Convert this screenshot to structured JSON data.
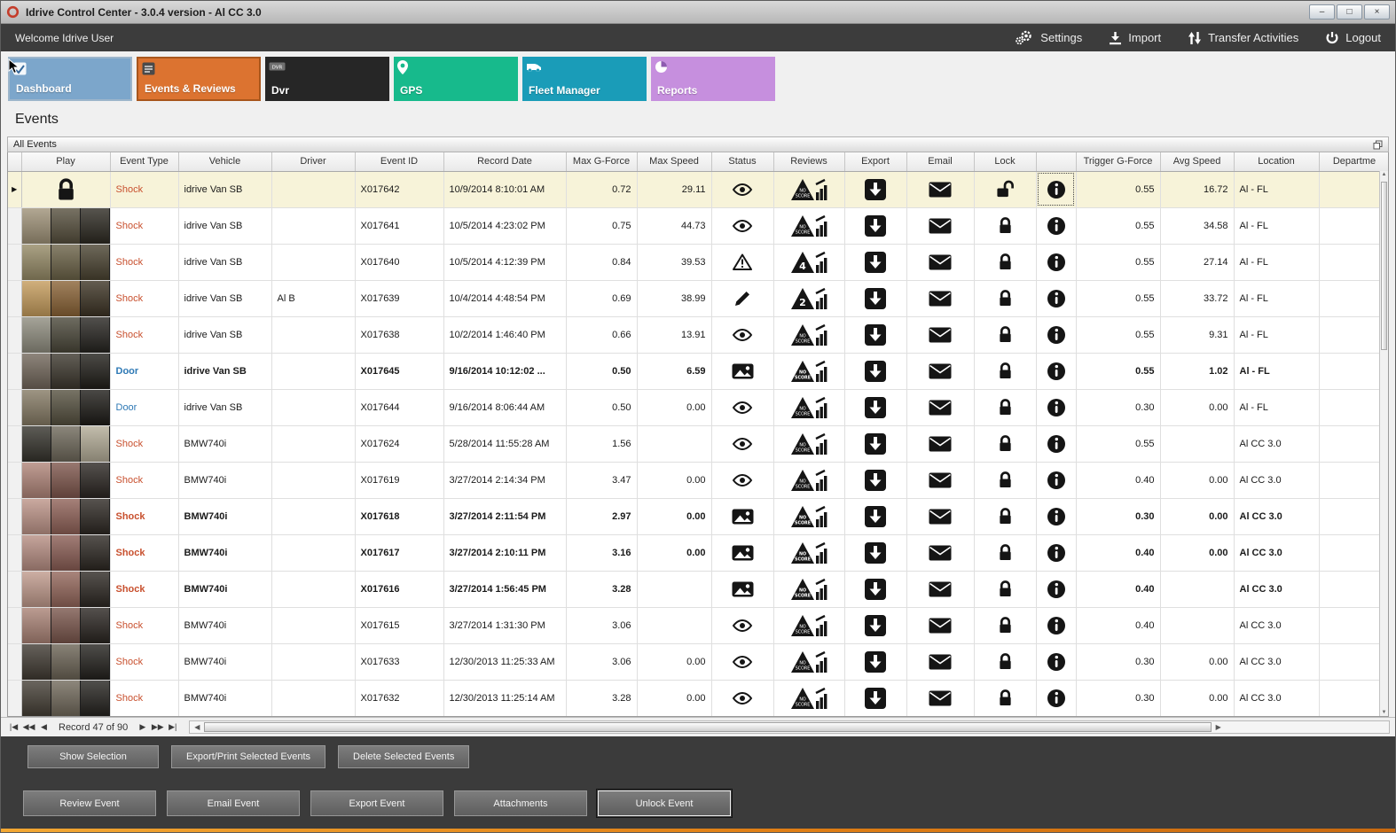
{
  "window_title": "Idrive Control Center - 3.0.4 version - Al CC 3.0",
  "window_controls": {
    "minimize": "–",
    "maximize": "□",
    "close": "×"
  },
  "topbar": {
    "welcome": "Welcome Idrive User",
    "actions": [
      {
        "id": "settings",
        "label": "Settings",
        "icon": "gear-icon"
      },
      {
        "id": "import",
        "label": "Import",
        "icon": "import-icon"
      },
      {
        "id": "transfer-activities",
        "label": "Transfer Activities",
        "icon": "transfer-icon"
      },
      {
        "id": "logout",
        "label": "Logout",
        "icon": "power-icon"
      }
    ]
  },
  "nav_tiles": [
    {
      "label": "Dashboard",
      "color": "#7CA6CB",
      "icon": "dashboard-icon",
      "selected": false,
      "hovered": true
    },
    {
      "label": "Events & Reviews",
      "color": "#DC7330",
      "icon": "events-icon",
      "selected": true,
      "hovered": false
    },
    {
      "label": "Dvr",
      "color": "#262626",
      "icon": "dvr-icon",
      "selected": false,
      "hovered": false
    },
    {
      "label": "GPS",
      "color": "#17BA8C",
      "icon": "gps-icon",
      "selected": false,
      "hovered": false
    },
    {
      "label": "Fleet Manager",
      "color": "#1A9CB8",
      "icon": "fleet-icon",
      "selected": false,
      "hovered": false
    },
    {
      "label": "Reports",
      "color": "#C68FDE",
      "icon": "reports-icon",
      "selected": false,
      "hovered": false
    }
  ],
  "page_title": "Events",
  "group_bar_label": "All Events",
  "table": {
    "columns": [
      "",
      "Play",
      "Event Type",
      "Vehicle",
      "Driver",
      "Event ID",
      "Record Date",
      "Max G-Force",
      "Max Speed",
      "Status",
      "Reviews",
      "Export",
      "Email",
      "Lock",
      "",
      "Trigger G-Force",
      "Avg Speed",
      "Location",
      "Departme"
    ],
    "rows": [
      {
        "play": "lock",
        "thumb": null,
        "type": "Shock",
        "vehicle": "idrive Van SB",
        "driver": "",
        "id": "X017642",
        "date": "10/9/2014 8:10:01 AM",
        "max_g": "0.72",
        "max_speed": "29.11",
        "status": "eye",
        "review": "NO SCORE",
        "lock": "unlocked",
        "trigger_g": "0.55",
        "avg_speed": "16.72",
        "location": "Al - FL",
        "selected": true,
        "bold": false,
        "info_focus": true
      },
      {
        "play": "thumb",
        "thumb": [
          "#9f9278",
          "#564f3d",
          "#2d2a22"
        ],
        "type": "Shock",
        "vehicle": "idrive Van SB",
        "driver": "",
        "id": "X017641",
        "date": "10/5/2014 4:23:02 PM",
        "max_g": "0.75",
        "max_speed": "44.73",
        "status": "eye",
        "review": "NO SCORE",
        "lock": "locked",
        "trigger_g": "0.55",
        "avg_speed": "34.58",
        "location": "Al - FL",
        "selected": false,
        "bold": false,
        "info_focus": false
      },
      {
        "play": "thumb",
        "thumb": [
          "#958a66",
          "#6b6247",
          "#4a4331"
        ],
        "type": "Shock",
        "vehicle": "idrive Van SB",
        "driver": "",
        "id": "X017640",
        "date": "10/5/2014 4:12:39 PM",
        "max_g": "0.84",
        "max_speed": "39.53",
        "status": "warning",
        "review": "4",
        "lock": "locked",
        "trigger_g": "0.55",
        "avg_speed": "27.14",
        "location": "Al - FL",
        "selected": false,
        "bold": false,
        "info_focus": false
      },
      {
        "play": "thumb",
        "thumb": [
          "#c59c5c",
          "#8a6336",
          "#3c3324"
        ],
        "type": "Shock",
        "vehicle": "idrive Van SB",
        "driver": "Al B",
        "id": "X017639",
        "date": "10/4/2014 4:48:54 PM",
        "max_g": "0.69",
        "max_speed": "38.99",
        "status": "pencil",
        "review": "2",
        "lock": "locked",
        "trigger_g": "0.55",
        "avg_speed": "33.72",
        "location": "Al - FL",
        "selected": false,
        "bold": false,
        "info_focus": false
      },
      {
        "play": "thumb",
        "thumb": [
          "#8f8d7f",
          "#4a4739",
          "#262420"
        ],
        "type": "Shock",
        "vehicle": "idrive Van SB",
        "driver": "",
        "id": "X017638",
        "date": "10/2/2014 1:46:40 PM",
        "max_g": "0.66",
        "max_speed": "13.91",
        "status": "eye",
        "review": "NO SCORE",
        "lock": "locked",
        "trigger_g": "0.55",
        "avg_speed": "9.31",
        "location": "Al - FL",
        "selected": false,
        "bold": false,
        "info_focus": false
      },
      {
        "play": "thumb",
        "thumb": [
          "#71665a",
          "#3c372d",
          "#201e19"
        ],
        "type": "Door",
        "vehicle": "idrive Van SB",
        "driver": "",
        "id": "X017645",
        "date": "9/16/2014 10:12:02 ...",
        "max_g": "0.50",
        "max_speed": "6.59",
        "status": "image",
        "review": "NO SCORE",
        "lock": "locked",
        "trigger_g": "0.55",
        "avg_speed": "1.02",
        "location": "Al - FL",
        "selected": false,
        "bold": true,
        "info_focus": false
      },
      {
        "play": "thumb",
        "thumb": [
          "#857a64",
          "#55503f",
          "#1d1b17"
        ],
        "type": "Door",
        "vehicle": "idrive Van SB",
        "driver": "",
        "id": "X017644",
        "date": "9/16/2014 8:06:44 AM",
        "max_g": "0.50",
        "max_speed": "0.00",
        "status": "eye",
        "review": "NO SCORE",
        "lock": "locked",
        "trigger_g": "0.30",
        "avg_speed": "0.00",
        "location": "Al - FL",
        "selected": false,
        "bold": false,
        "info_focus": false
      },
      {
        "play": "thumb",
        "thumb": [
          "#35332c",
          "#6e685a",
          "#b3ac97"
        ],
        "type": "Shock",
        "vehicle": "BMW740i",
        "driver": "",
        "id": "X017624",
        "date": "5/28/2014 11:55:28 AM",
        "max_g": "1.56",
        "max_speed": "",
        "status": "eye",
        "review": "NO SCORE",
        "lock": "locked",
        "trigger_g": "0.55",
        "avg_speed": "",
        "location": "Al CC 3.0",
        "selected": false,
        "bold": false,
        "info_focus": false
      },
      {
        "play": "thumb",
        "thumb": [
          "#b08579",
          "#7e564c",
          "#2b2622"
        ],
        "type": "Shock",
        "vehicle": "BMW740i",
        "driver": "",
        "id": "X017619",
        "date": "3/27/2014 2:14:34 PM",
        "max_g": "3.47",
        "max_speed": "0.00",
        "status": "eye",
        "review": "NO SCORE",
        "lock": "locked",
        "trigger_g": "0.40",
        "avg_speed": "0.00",
        "location": "Al CC 3.0",
        "selected": false,
        "bold": false,
        "info_focus": false
      },
      {
        "play": "thumb",
        "thumb": [
          "#bd9488",
          "#8f6157",
          "#2d2823"
        ],
        "type": "Shock",
        "vehicle": "BMW740i",
        "driver": "",
        "id": "X017618",
        "date": "3/27/2014 2:11:54 PM",
        "max_g": "2.97",
        "max_speed": "0.00",
        "status": "image",
        "review": "NO SCORE",
        "lock": "locked",
        "trigger_g": "0.30",
        "avg_speed": "0.00",
        "location": "Al CC 3.0",
        "selected": false,
        "bold": true,
        "info_focus": false
      },
      {
        "play": "thumb",
        "thumb": [
          "#b78e83",
          "#8a5d54",
          "#2c2722"
        ],
        "type": "Shock",
        "vehicle": "BMW740i",
        "driver": "",
        "id": "X017617",
        "date": "3/27/2014 2:10:11 PM",
        "max_g": "3.16",
        "max_speed": "0.00",
        "status": "image",
        "review": "NO SCORE",
        "lock": "locked",
        "trigger_g": "0.40",
        "avg_speed": "0.00",
        "location": "Al CC 3.0",
        "selected": false,
        "bold": true,
        "info_focus": false
      },
      {
        "play": "thumb",
        "thumb": [
          "#c09a8c",
          "#93665a",
          "#2d2823"
        ],
        "type": "Shock",
        "vehicle": "BMW740i",
        "driver": "",
        "id": "X017616",
        "date": "3/27/2014 1:56:45 PM",
        "max_g": "3.28",
        "max_speed": "",
        "status": "image",
        "review": "NO SCORE",
        "lock": "locked",
        "trigger_g": "0.40",
        "avg_speed": "",
        "location": "Al CC 3.0",
        "selected": false,
        "bold": true,
        "info_focus": false
      },
      {
        "play": "thumb",
        "thumb": [
          "#aa8376",
          "#7a564c",
          "#2a2521"
        ],
        "type": "Shock",
        "vehicle": "BMW740i",
        "driver": "",
        "id": "X017615",
        "date": "3/27/2014 1:31:30 PM",
        "max_g": "3.06",
        "max_speed": "",
        "status": "eye",
        "review": "NO SCORE",
        "lock": "locked",
        "trigger_g": "0.40",
        "avg_speed": "",
        "location": "Al CC 3.0",
        "selected": false,
        "bold": false,
        "info_focus": false
      },
      {
        "play": "thumb",
        "thumb": [
          "#403a32",
          "#6b6355",
          "#23211d"
        ],
        "type": "Shock",
        "vehicle": "BMW740i",
        "driver": "",
        "id": "X017633",
        "date": "12/30/2013 11:25:33 AM",
        "max_g": "3.06",
        "max_speed": "0.00",
        "status": "eye",
        "review": "NO SCORE",
        "lock": "locked",
        "trigger_g": "0.30",
        "avg_speed": "0.00",
        "location": "Al CC 3.0",
        "selected": false,
        "bold": false,
        "info_focus": false
      },
      {
        "play": "thumb",
        "thumb": [
          "#453f36",
          "#71695b",
          "#25231f"
        ],
        "type": "Shock",
        "vehicle": "BMW740i",
        "driver": "",
        "id": "X017632",
        "date": "12/30/2013 11:25:14 AM",
        "max_g": "3.28",
        "max_speed": "0.00",
        "status": "eye",
        "review": "NO SCORE",
        "lock": "locked",
        "trigger_g": "0.30",
        "avg_speed": "0.00",
        "location": "Al CC 3.0",
        "selected": false,
        "bold": false,
        "info_focus": false
      }
    ]
  },
  "pager": {
    "record_text": "Record 47 of 90",
    "nav_first": "|◀",
    "nav_prevpage": "◀◀",
    "nav_prev": "◀",
    "nav_next": "▶",
    "nav_nextpage": "▶▶",
    "nav_last": "▶|",
    "scroll_left": "◀",
    "scroll_right": "▶",
    "vscroll_up": "▲",
    "vscroll_down": "▼"
  },
  "selection_buttons": [
    "Show Selection",
    "Export/Print Selected Events",
    "Delete Selected  Events"
  ],
  "event_buttons": [
    {
      "label": "Review Event",
      "focused": false
    },
    {
      "label": "Email Event",
      "focused": false
    },
    {
      "label": "Export Event",
      "focused": false
    },
    {
      "label": "Attachments",
      "focused": false
    },
    {
      "label": "Unlock Event",
      "focused": true
    }
  ],
  "colors": {
    "accent_orange": "#DC7330",
    "selected_row": "#F7F3D9",
    "shock_text": "#C8502E",
    "door_text": "#2E79B5"
  }
}
